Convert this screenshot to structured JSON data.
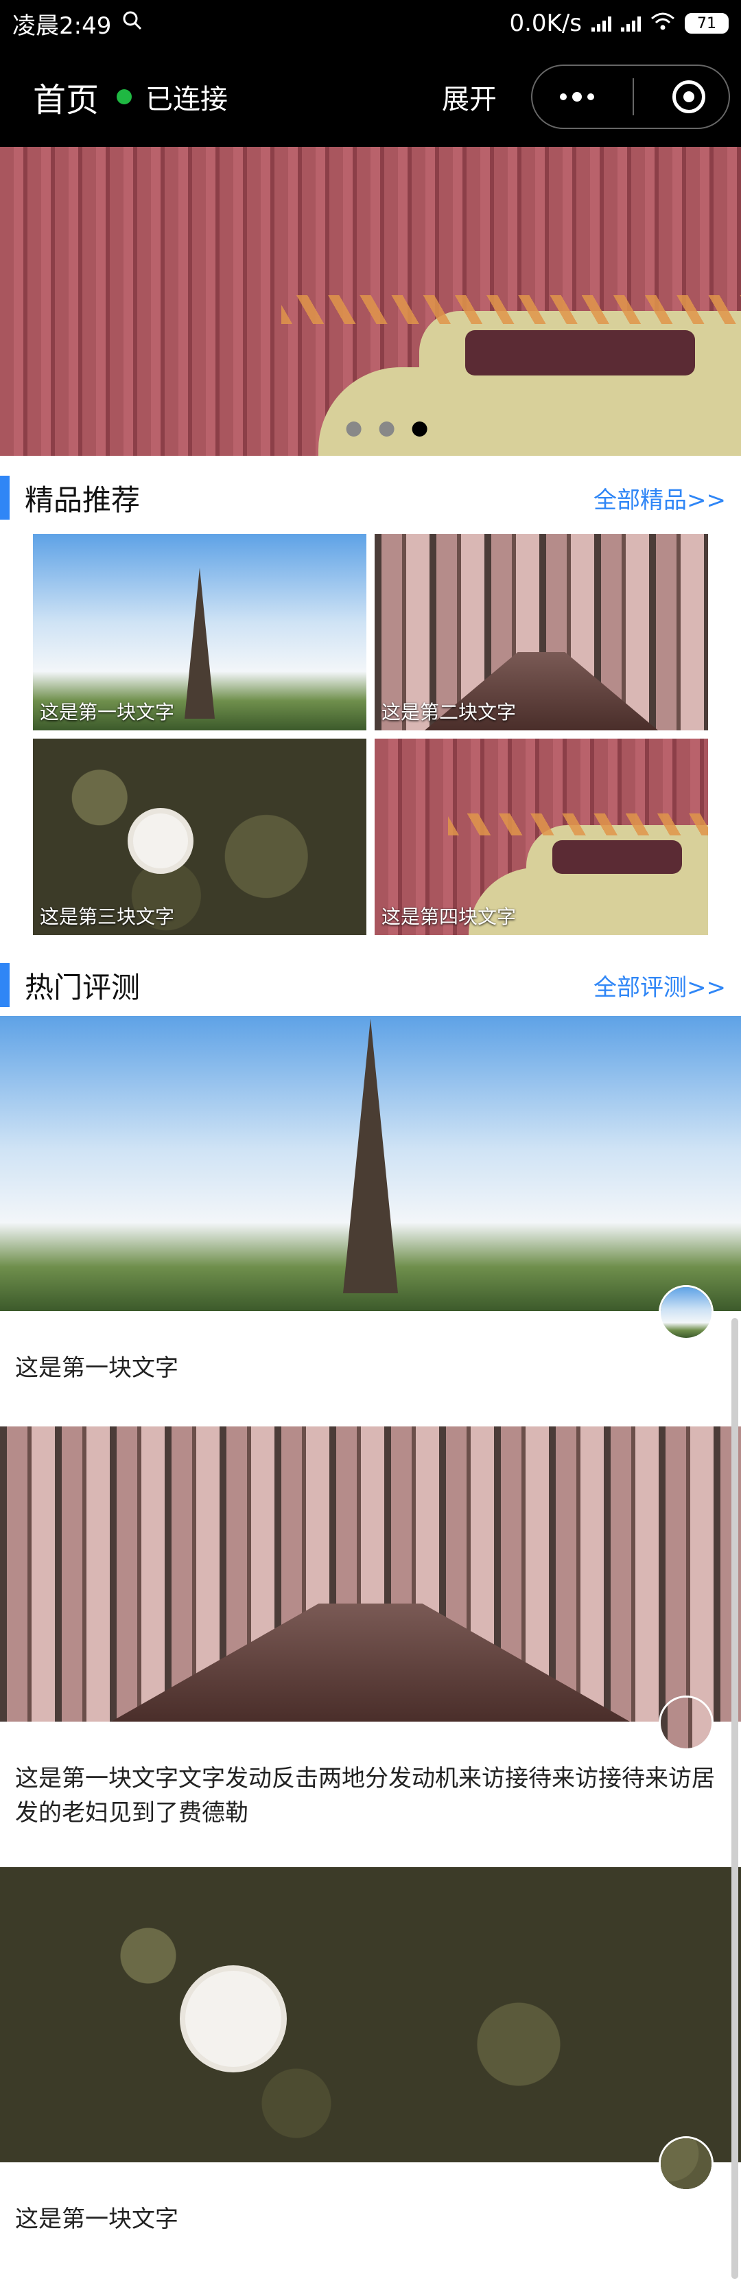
{
  "status_bar": {
    "time": "凌晨2:49",
    "net_speed": "0.0K/s",
    "battery": "71"
  },
  "navbar": {
    "title": "首页",
    "connection": "已连接",
    "expand": "展开"
  },
  "banner": {
    "dot_count": 3,
    "active_dot_index": 2
  },
  "featured": {
    "title": "精品推荐",
    "link": "全部精品>>",
    "items": [
      {
        "caption": "这是第一块文字"
      },
      {
        "caption": "这是第二块文字"
      },
      {
        "caption": "这是第三块文字"
      },
      {
        "caption": "这是第四块文字"
      }
    ]
  },
  "reviews": {
    "title": "热门评测",
    "link": "全部评测>>",
    "items": [
      {
        "text": "这是第一块文字"
      },
      {
        "text": "这是第一块文字文字发动反击两地分发动机来访接待来访接待来访居发的老妇见到了费德勒"
      },
      {
        "text": "这是第一块文字"
      }
    ]
  },
  "colors": {
    "accent": "#2f86f6",
    "connected": "#1fb842",
    "nav_bg": "#000000"
  }
}
